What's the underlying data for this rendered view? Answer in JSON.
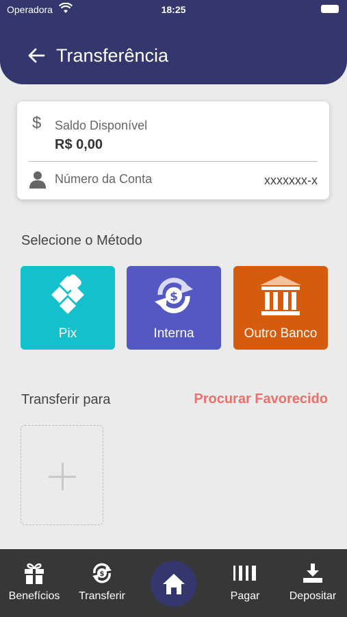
{
  "status_bar": {
    "carrier": "Operadora",
    "time": "18:25"
  },
  "header": {
    "title": "Transferência"
  },
  "account_card": {
    "balance_label": "Saldo Disponível",
    "balance_value": "R$ 0,00",
    "account_label": "Número da Conta",
    "account_value": "xxxxxxx-x"
  },
  "methods": {
    "section_title": "Selecione o Método",
    "items": [
      {
        "label": "Pix",
        "icon": "pix-icon",
        "color": "#14c0cc"
      },
      {
        "label": "Interna",
        "icon": "exchange-icon",
        "color": "#5358c3"
      },
      {
        "label": "Outro Banco",
        "icon": "bank-icon",
        "color": "#d45c0c"
      }
    ]
  },
  "transfer_to": {
    "section_title": "Transferir para",
    "search_label": "Procurar Favorecido",
    "search_color": "#ee6f6a"
  },
  "tabbar": {
    "items": [
      {
        "label": "Benefícios",
        "icon": "gift-icon"
      },
      {
        "label": "Transferir",
        "icon": "transfer-icon"
      },
      {
        "label": "",
        "icon": "home-icon"
      },
      {
        "label": "Pagar",
        "icon": "barcode-icon"
      },
      {
        "label": "Depositar",
        "icon": "download-icon"
      }
    ]
  },
  "colors": {
    "primary": "#34376e",
    "background": "#ebebeb",
    "tabbar": "#373737"
  }
}
